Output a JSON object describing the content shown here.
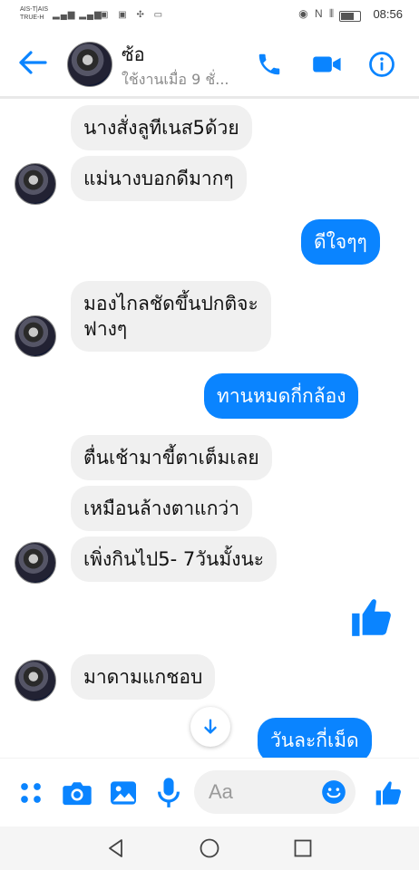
{
  "status_bar": {
    "carrier_line1": "AIS-T|AIS",
    "carrier_line2": "TRUE-H",
    "signal": "▂▄▆ ▂▄▆",
    "icons": "◉ N ⫴",
    "time": "08:56"
  },
  "header": {
    "contact_name": "ซ้อ",
    "active_status": "ใช้งานเมื่อ 9 ชั่..."
  },
  "messages": [
    {
      "from": "them",
      "text": "นางสั่งลูทีเนส5ด้วย"
    },
    {
      "from": "them",
      "text": "แม่นางบอกดีมากๆ"
    },
    {
      "from": "me",
      "text": "ดีใจๆๆ"
    },
    {
      "from": "them",
      "text_line1": "มองไกลชัดขึ้นปกติจะ",
      "text_line2": "ฟางๆ"
    },
    {
      "from": "me",
      "text": "ทานหมดกี่กล้อง"
    },
    {
      "from": "them",
      "text": "ตื่นเช้ามาขี้ตาเต็มเลย"
    },
    {
      "from": "them",
      "text": "เหมือนล้างตาแกว่า"
    },
    {
      "from": "them",
      "text": "เพิ่งกินไป5- 7วันมั้งนะ"
    },
    {
      "from": "me",
      "type": "like"
    },
    {
      "from": "them",
      "text": "มาดามแกชอบ"
    },
    {
      "from": "me",
      "text": "วันละกี่เม็ด"
    }
  ],
  "composer": {
    "placeholder": "Aa"
  },
  "colors": {
    "accent": "#0a84ff",
    "incoming_bubble": "#f0f0f0"
  },
  "icons": {
    "back": "back-arrow-icon",
    "call": "phone-icon",
    "video": "video-camera-icon",
    "info": "info-icon",
    "menu": "four-dots-icon",
    "camera": "camera-icon",
    "gallery": "image-icon",
    "mic": "microphone-icon",
    "emoji": "emoji-icon",
    "like": "thumbs-up-icon"
  }
}
